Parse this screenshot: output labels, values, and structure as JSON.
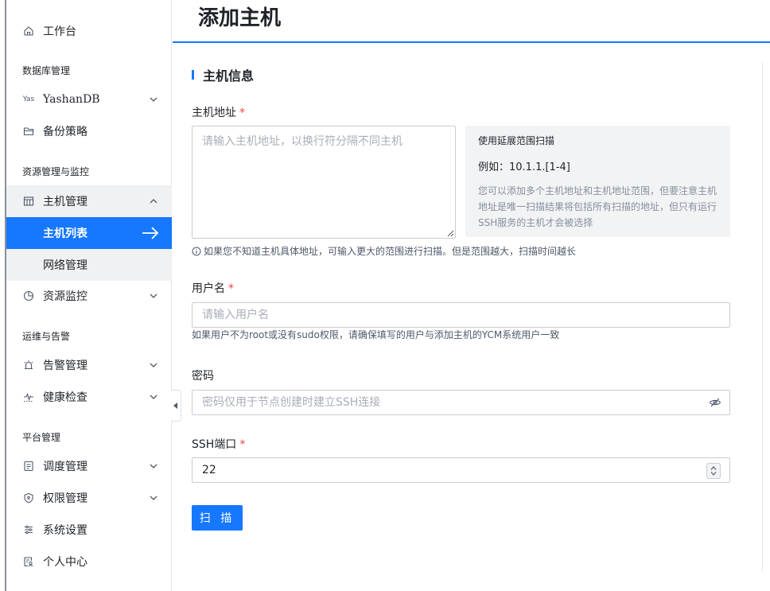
{
  "sidebar": {
    "workbench": "工作台",
    "group_db": "数据库管理",
    "yashandb": "YashanDB",
    "yashandb_icon_text": "Yas",
    "backup": "备份策略",
    "group_resource": "资源管理与监控",
    "host_mgmt": "主机管理",
    "host_list": "主机列表",
    "network_mgmt": "网络管理",
    "resource_monitor": "资源监控",
    "group_ops": "运维与告警",
    "alert_mgmt": "告警管理",
    "health_check": "健康检查",
    "group_platform": "平台管理",
    "schedule_mgmt": "调度管理",
    "permission_mgmt": "权限管理",
    "system_settings": "系统设置",
    "personal_center": "个人中心"
  },
  "header": {
    "title": "添加主机"
  },
  "form": {
    "section_title": "主机信息",
    "host_address_label": "主机地址",
    "required_mark": "*",
    "host_address_placeholder": "请输入主机地址，以换行符分隔不同主机",
    "hint_title": "使用延展范围扫描",
    "hint_example": "例如：10.1.1.[1-4]",
    "hint_desc": "您可以添加多个主机地址和主机地址范围，但要注意主机地址是唯一扫描结果将包括所有扫描的地址，但只有运行SSH服务的主机才会被选择",
    "host_info_tip": "如果您不知道主机具体地址，可输入更大的范围进行扫描。但是范围越大，扫描时间越长",
    "username_label": "用户名",
    "username_placeholder": "请输入用户名",
    "username_help": "如果用户不为root或没有sudo权限，请确保填写的用户与添加主机的YCM系统用户一致",
    "password_label": "密码",
    "password_placeholder": "密码仅用于节点创建时建立SSH连接",
    "ssh_port_label": "SSH端口",
    "ssh_port_value": "22",
    "scan_button": "扫 描"
  },
  "colors": {
    "accent": "#1677ff",
    "required": "#f53f3f"
  }
}
